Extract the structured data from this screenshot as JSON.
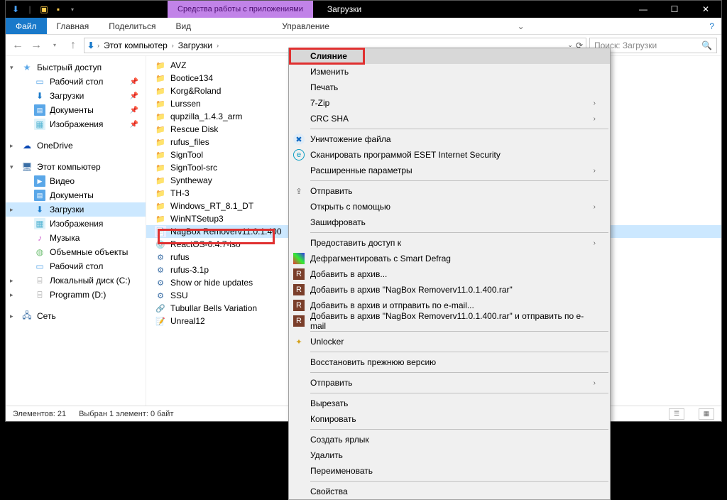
{
  "titlebar": {
    "tools_label": "Средства работы с приложениями",
    "window_title": "Загрузки"
  },
  "ribbon": {
    "file": "Файл",
    "home": "Главная",
    "share": "Поделиться",
    "view": "Вид",
    "manage": "Управление"
  },
  "address": {
    "root": "Этот компьютер",
    "folder": "Загрузки",
    "search_placeholder": "Поиск: Загрузки"
  },
  "nav": {
    "quick": "Быстрый доступ",
    "desktop": "Рабочий стол",
    "downloads": "Загрузки",
    "documents": "Документы",
    "pictures": "Изображения",
    "onedrive": "OneDrive",
    "thispc": "Этот компьютер",
    "videos": "Видео",
    "documents2": "Документы",
    "downloads2": "Загрузки",
    "pictures2": "Изображения",
    "music": "Музыка",
    "objects3d": "Объемные объекты",
    "desktop2": "Рабочий стол",
    "localdisk": "Локальный диск (C:)",
    "programm": "Programm (D:)",
    "network": "Сеть"
  },
  "files": [
    {
      "name": "AVZ",
      "t": "folder"
    },
    {
      "name": "Bootice134",
      "t": "folder"
    },
    {
      "name": "Korg&Roland",
      "t": "folder"
    },
    {
      "name": "Lurssen",
      "t": "folder"
    },
    {
      "name": "qupzilla_1.4.3_arm",
      "t": "folder"
    },
    {
      "name": "Rescue Disk",
      "t": "folder"
    },
    {
      "name": "rufus_files",
      "t": "folder"
    },
    {
      "name": "SignTool",
      "t": "folder"
    },
    {
      "name": "SignTool-src",
      "t": "folder"
    },
    {
      "name": "Syntheway",
      "t": "folder"
    },
    {
      "name": "TH-3",
      "t": "folder"
    },
    {
      "name": "Windows_RT_8.1_DT",
      "t": "folder"
    },
    {
      "name": "WinNTSetup3",
      "t": "folder"
    },
    {
      "name": "NagBox Removerv11.0.1.400",
      "t": "reg",
      "sel": true
    },
    {
      "name": "ReactOS-0.4.7-iso",
      "t": "iso"
    },
    {
      "name": "rufus",
      "t": "exe"
    },
    {
      "name": "rufus-3.1p",
      "t": "exe"
    },
    {
      "name": "Show or hide updates",
      "t": "exe"
    },
    {
      "name": "SSU",
      "t": "exe"
    },
    {
      "name": "Tubullar Bells Variation",
      "t": "lnk"
    },
    {
      "name": "Unreal12",
      "t": "txt"
    }
  ],
  "status": {
    "count": "Элементов: 21",
    "selection": "Выбран 1 элемент: 0 байт"
  },
  "ctx": {
    "merge": "Слияние",
    "edit": "Изменить",
    "print": "Печать",
    "sevenzip": "7-Zip",
    "crc": "CRC SHA",
    "shred": "Уничтожение файла",
    "eset": "Сканировать программой ESET Internet Security",
    "adv": "Расширенные параметры",
    "sendto": "Отправить",
    "openwith": "Открыть с помощью",
    "encrypt": "Зашифровать",
    "share": "Предоставить доступ к",
    "defrag": "Дефрагментировать с Smart Defrag",
    "addarch": "Добавить в архив...",
    "addrar": "Добавить в архив \"NagBox Removerv11.0.1.400.rar\"",
    "addmail": "Добавить в архив и отправить по e-mail...",
    "addrarmail": "Добавить в архив \"NagBox Removerv11.0.1.400.rar\" и отправить по e-mail",
    "unlocker": "Unlocker",
    "restore": "Восстановить прежнюю версию",
    "sendto2": "Отправить",
    "cut": "Вырезать",
    "copy": "Копировать",
    "shortcut": "Создать ярлык",
    "delete": "Удалить",
    "rename": "Переименовать",
    "props": "Свойства"
  }
}
